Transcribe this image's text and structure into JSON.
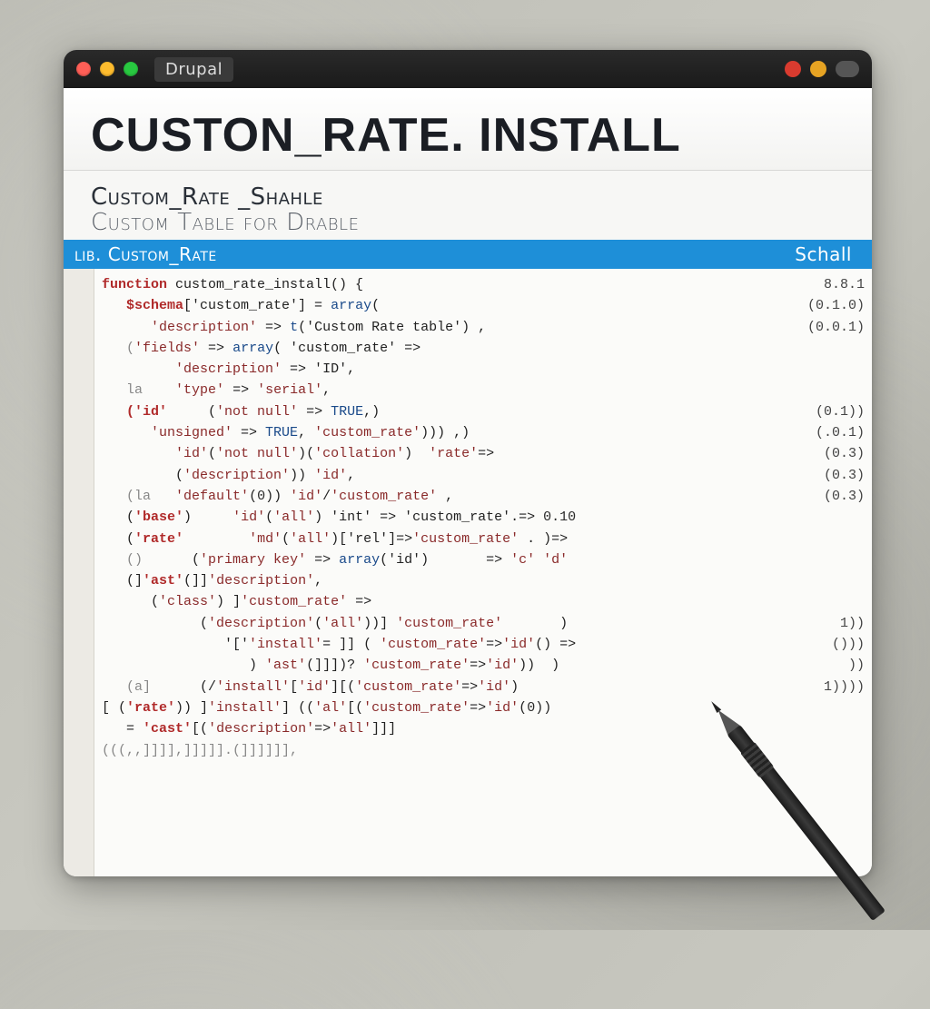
{
  "titlebar": {
    "app_label": "Drupal"
  },
  "header": {
    "title": "CUSTON_RATE. INSTALL",
    "subtitle_1": "Custom_Rate _Shahle",
    "subtitle_2": "Custom Table for Drable"
  },
  "blue_bar": {
    "left": "lib. Custom_Rate",
    "right": "Schall"
  },
  "side_labels": [
    "8.8.1",
    "(0.1.0)",
    "(0.0.1)",
    "",
    "",
    "",
    "(0.1))",
    "(.0.1)",
    "(0.3)",
    "(0.3)",
    "(0.3)",
    "",
    "",
    "",
    "",
    "",
    "1))",
    "()))",
    "))",
    "1))))",
    "",
    ""
  ],
  "code_lines": [
    {
      "indent": 0,
      "segs": [
        {
          "t": "function",
          "c": "kw"
        },
        {
          "t": " custom_rate_install() {",
          "c": ""
        }
      ]
    },
    {
      "indent": 1,
      "segs": [
        {
          "t": "$schema",
          "c": "kw"
        },
        {
          "t": "['custom_rate'] = ",
          "c": ""
        },
        {
          "t": "array",
          "c": "fn"
        },
        {
          "t": "(",
          "c": ""
        }
      ]
    },
    {
      "indent": 2,
      "segs": [
        {
          "t": "'description'",
          "c": "str"
        },
        {
          "t": " => ",
          "c": ""
        },
        {
          "t": "t",
          "c": "fn"
        },
        {
          "t": "('Custom Rate table') ,",
          "c": ""
        }
      ]
    },
    {
      "indent": 1,
      "segs": [
        {
          "t": "(",
          "c": "dim"
        },
        {
          "t": "'fields'",
          "c": "str"
        },
        {
          "t": " => ",
          "c": ""
        },
        {
          "t": "array",
          "c": "fn"
        },
        {
          "t": "( 'custom_rate' =>",
          "c": ""
        }
      ]
    },
    {
      "indent": 3,
      "segs": [
        {
          "t": "'description'",
          "c": "str"
        },
        {
          "t": " => '",
          "c": ""
        },
        {
          "t": "ID",
          "c": ""
        },
        {
          "t": "',",
          "c": ""
        }
      ]
    },
    {
      "indent": 1,
      "segs": [
        {
          "t": "la",
          "c": "dim"
        },
        {
          "t": "    ",
          "c": ""
        },
        {
          "t": "'type'",
          "c": "str"
        },
        {
          "t": " => ",
          "c": ""
        },
        {
          "t": "'serial'",
          "c": "str"
        },
        {
          "t": ",",
          "c": ""
        }
      ]
    },
    {
      "indent": 1,
      "segs": [
        {
          "t": "('id'",
          "c": "kw"
        },
        {
          "t": "     (",
          "c": ""
        },
        {
          "t": "'not null'",
          "c": "str"
        },
        {
          "t": " => ",
          "c": ""
        },
        {
          "t": "TRUE",
          "c": "fn"
        },
        {
          "t": ",)",
          "c": ""
        }
      ]
    },
    {
      "indent": 2,
      "segs": [
        {
          "t": "'unsigned'",
          "c": "str"
        },
        {
          "t": " => ",
          "c": ""
        },
        {
          "t": "TRUE",
          "c": "fn"
        },
        {
          "t": ", ",
          "c": ""
        },
        {
          "t": "'custom_rate'",
          "c": "str"
        },
        {
          "t": "))) ,)",
          "c": ""
        }
      ]
    },
    {
      "indent": 3,
      "segs": [
        {
          "t": "'id'",
          "c": "str"
        },
        {
          "t": "(",
          "c": ""
        },
        {
          "t": "'not null'",
          "c": "str"
        },
        {
          "t": ")(",
          "c": ""
        },
        {
          "t": "'collation'",
          "c": "str"
        },
        {
          "t": ")  ",
          "c": ""
        },
        {
          "t": "'rate'",
          "c": "str"
        },
        {
          "t": "=>",
          "c": ""
        }
      ]
    },
    {
      "indent": 3,
      "segs": [
        {
          "t": "(",
          "c": ""
        },
        {
          "t": "'description'",
          "c": "str"
        },
        {
          "t": ")) ",
          "c": ""
        },
        {
          "t": "'id'",
          "c": "str"
        },
        {
          "t": ",",
          "c": ""
        }
      ]
    },
    {
      "indent": 1,
      "segs": [
        {
          "t": "(la",
          "c": "dim"
        },
        {
          "t": "   ",
          "c": ""
        },
        {
          "t": "'default'",
          "c": "str"
        },
        {
          "t": "(",
          "c": ""
        },
        {
          "t": "0",
          "c": "num"
        },
        {
          "t": ")) ",
          "c": ""
        },
        {
          "t": "'id'",
          "c": "str"
        },
        {
          "t": "/",
          "c": ""
        },
        {
          "t": "'custom_rate'",
          "c": "str"
        },
        {
          "t": " ,",
          "c": ""
        }
      ]
    },
    {
      "indent": 1,
      "segs": [
        {
          "t": "(",
          "c": ""
        },
        {
          "t": "'base'",
          "c": "kw"
        },
        {
          "t": ")     ",
          "c": ""
        },
        {
          "t": "'id'",
          "c": "str"
        },
        {
          "t": "(",
          "c": ""
        },
        {
          "t": "'all'",
          "c": "str"
        },
        {
          "t": ") 'int' => 'custom_rate'.=> ",
          "c": ""
        },
        {
          "t": "0.10",
          "c": "num"
        }
      ]
    },
    {
      "indent": 1,
      "segs": [
        {
          "t": "(",
          "c": ""
        },
        {
          "t": "'rate'",
          "c": "kw"
        },
        {
          "t": "        ",
          "c": ""
        },
        {
          "t": "'md'",
          "c": "str"
        },
        {
          "t": "(",
          "c": ""
        },
        {
          "t": "'all'",
          "c": "str"
        },
        {
          "t": ")['rel']=>",
          "c": ""
        },
        {
          "t": "'custom_rate'",
          "c": "str"
        },
        {
          "t": " . )=>",
          "c": ""
        }
      ]
    },
    {
      "indent": 1,
      "segs": [
        {
          "t": "()",
          "c": "dim"
        },
        {
          "t": "      (",
          "c": ""
        },
        {
          "t": "'primary key'",
          "c": "str"
        },
        {
          "t": " => ",
          "c": ""
        },
        {
          "t": "array",
          "c": "fn"
        },
        {
          "t": "('id')       => ",
          "c": ""
        },
        {
          "t": "'c'",
          "c": "str"
        },
        {
          "t": " ",
          "c": ""
        },
        {
          "t": "'d'",
          "c": "str"
        }
      ]
    },
    {
      "indent": 1,
      "segs": [
        {
          "t": "(]",
          "c": ""
        },
        {
          "t": "'ast'",
          "c": "kw"
        },
        {
          "t": "(]]",
          "c": ""
        },
        {
          "t": "'description'",
          "c": "str"
        },
        {
          "t": ",",
          "c": ""
        }
      ]
    },
    {
      "indent": 2,
      "segs": [
        {
          "t": "(",
          "c": ""
        },
        {
          "t": "'class'",
          "c": "str"
        },
        {
          "t": ") ]",
          "c": ""
        },
        {
          "t": "'custom_rate'",
          "c": "str"
        },
        {
          "t": " =>",
          "c": ""
        }
      ]
    },
    {
      "indent": 4,
      "segs": [
        {
          "t": "(",
          "c": ""
        },
        {
          "t": "'description'",
          "c": "str"
        },
        {
          "t": "(",
          "c": ""
        },
        {
          "t": "'all'",
          "c": "str"
        },
        {
          "t": "))] ",
          "c": ""
        },
        {
          "t": "'custom_rate'",
          "c": "str"
        },
        {
          "t": "       )",
          "c": ""
        }
      ]
    },
    {
      "indent": 5,
      "segs": [
        {
          "t": "'['",
          "c": ""
        },
        {
          "t": "'install'",
          "c": "str"
        },
        {
          "t": "= ]] ( ",
          "c": ""
        },
        {
          "t": "'custom_rate'",
          "c": "str"
        },
        {
          "t": "=>",
          "c": ""
        },
        {
          "t": "'id'",
          "c": "str"
        },
        {
          "t": "() =>",
          "c": ""
        }
      ]
    },
    {
      "indent": 6,
      "segs": [
        {
          "t": ") ",
          "c": ""
        },
        {
          "t": "'ast'",
          "c": "str"
        },
        {
          "t": "(]]])? ",
          "c": ""
        },
        {
          "t": "'custom_rate'",
          "c": "str"
        },
        {
          "t": "=>",
          "c": ""
        },
        {
          "t": "'id'",
          "c": "str"
        },
        {
          "t": "))  )",
          "c": ""
        }
      ]
    },
    {
      "indent": 1,
      "segs": [
        {
          "t": "(a]",
          "c": "dim"
        },
        {
          "t": "      (/",
          "c": ""
        },
        {
          "t": "'install'",
          "c": "str"
        },
        {
          "t": "[",
          "c": ""
        },
        {
          "t": "'id'",
          "c": "str"
        },
        {
          "t": "][(",
          "c": ""
        },
        {
          "t": "'custom_rate'",
          "c": "str"
        },
        {
          "t": "=>",
          "c": ""
        },
        {
          "t": "'id'",
          "c": "str"
        },
        {
          "t": ")",
          "c": ""
        }
      ]
    },
    {
      "indent": 0,
      "segs": [
        {
          "t": "[ (",
          "c": ""
        },
        {
          "t": "'rate'",
          "c": "kw"
        },
        {
          "t": ")) ]",
          "c": ""
        },
        {
          "t": "'install'",
          "c": "str"
        },
        {
          "t": "] ((",
          "c": ""
        },
        {
          "t": "'al'",
          "c": "str"
        },
        {
          "t": "[(",
          "c": ""
        },
        {
          "t": "'custom_rate'",
          "c": "str"
        },
        {
          "t": "=>",
          "c": ""
        },
        {
          "t": "'id'",
          "c": "str"
        },
        {
          "t": "(",
          "c": ""
        },
        {
          "t": "0",
          "c": "num"
        },
        {
          "t": "))",
          "c": ""
        }
      ]
    },
    {
      "indent": 1,
      "segs": [
        {
          "t": "= ",
          "c": ""
        },
        {
          "t": "'cast'",
          "c": "kw"
        },
        {
          "t": "[(",
          "c": ""
        },
        {
          "t": "'description'",
          "c": "str"
        },
        {
          "t": "=>",
          "c": ""
        },
        {
          "t": "'all'",
          "c": "str"
        },
        {
          "t": "]]]",
          "c": ""
        }
      ]
    },
    {
      "indent": 0,
      "segs": [
        {
          "t": "(((,,]]]],]]]]].(]]]]]],",
          "c": "dim"
        }
      ]
    }
  ]
}
